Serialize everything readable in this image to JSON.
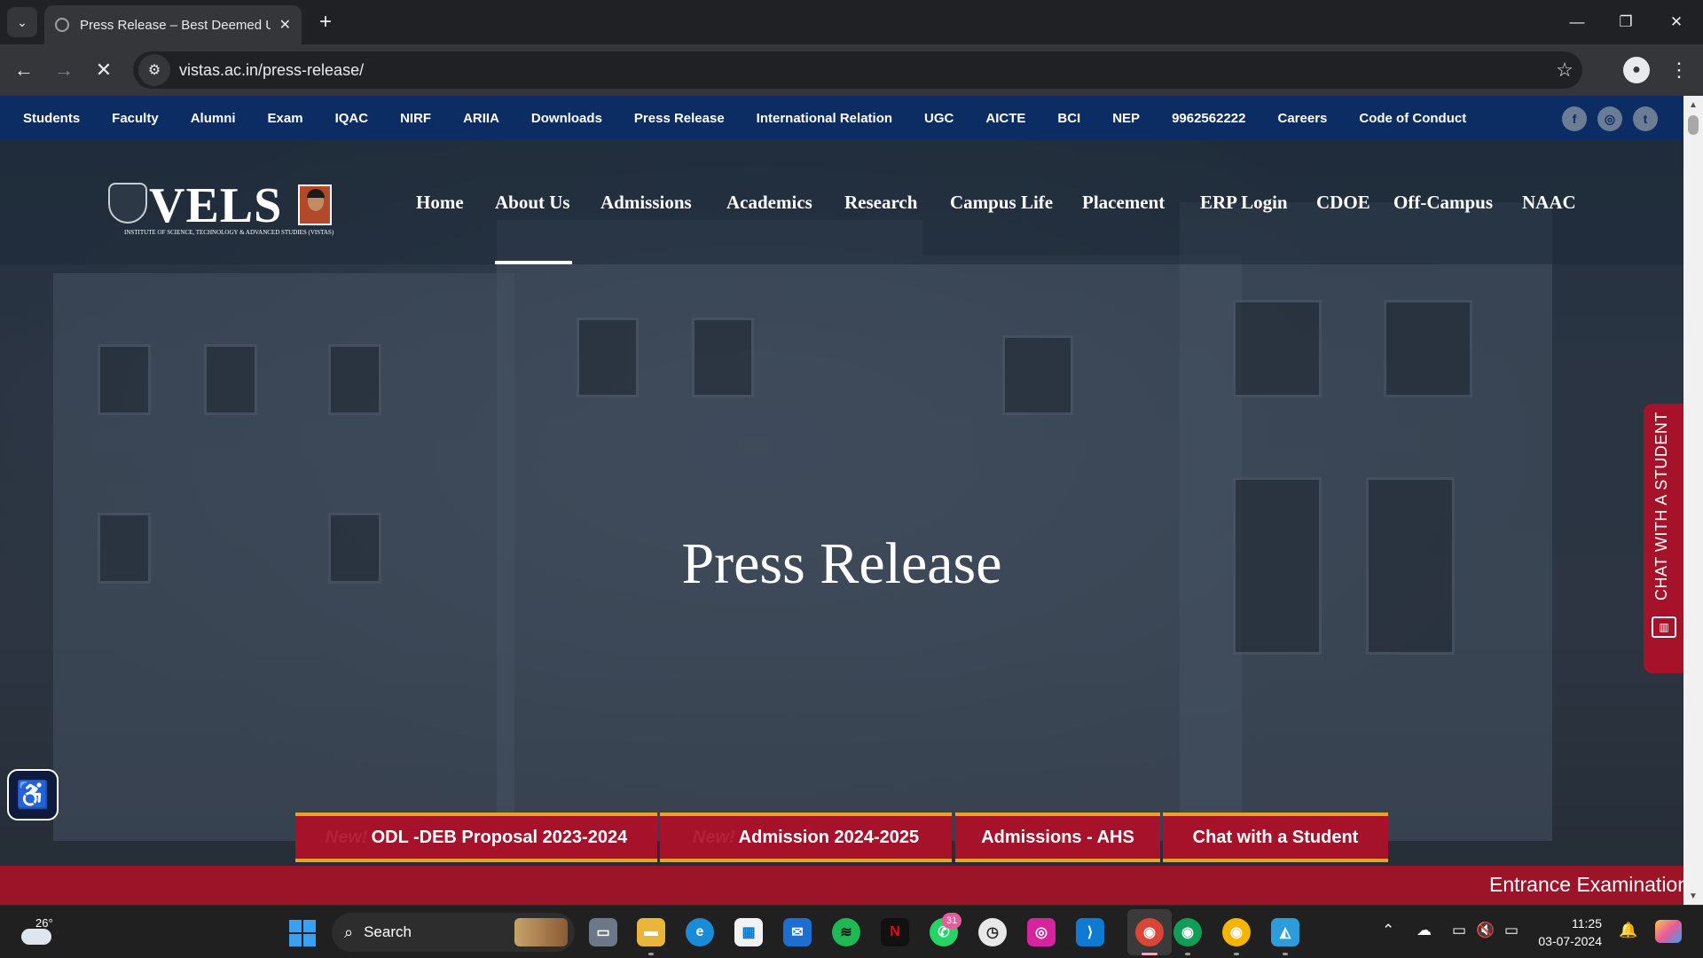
{
  "browser": {
    "tab_title": "Press Release – Best Deemed U",
    "url": "vistas.ac.in/press-release/",
    "icons": {
      "tab_list": "chevron-down-icon",
      "new_tab": "plus-icon",
      "back": "arrow-left-icon",
      "forward": "arrow-right-icon",
      "stop": "close-icon",
      "site_info": "tune-icon",
      "bookmark": "star-icon",
      "profile": "person-icon",
      "menu": "kebab-icon"
    }
  },
  "glyphs": {
    "chevron": "⌄",
    "close": "✕",
    "plus": "+",
    "back": "←",
    "forward": "→",
    "minimize": "—",
    "restore": "❐",
    "site": "⚙",
    "star": "☆",
    "person": "●",
    "kebab": "⋮",
    "scroll_up": "▲",
    "scroll_down": "▼",
    "a11y": "♿",
    "search": "⌕",
    "chevron_up": "⌃",
    "cloud": "☁",
    "monitor": "▭",
    "mute": "🔇",
    "battery": "▭",
    "bell": "🔔"
  },
  "top_bar": {
    "links": [
      "Students",
      "Faculty",
      "Alumni",
      "Exam",
      "IQAC",
      "NIRF",
      "ARIIA",
      "Downloads",
      "Press Release",
      "International Relation",
      "UGC",
      "AICTE",
      "BCI",
      "NEP",
      "9962562222",
      "Careers",
      "Code of Conduct"
    ],
    "social": [
      {
        "icon": "facebook-icon",
        "glyph": "f"
      },
      {
        "icon": "instagram-icon",
        "glyph": "◎"
      },
      {
        "icon": "twitter-icon",
        "glyph": "t"
      }
    ]
  },
  "logo": {
    "word": "VELS",
    "subtitle": "INSTITUTE OF SCIENCE, TECHNOLOGY & ADVANCED STUDIES (VISTAS)"
  },
  "main_nav": {
    "items": [
      "Home",
      "About Us",
      "Admissions",
      "Academics",
      "Research",
      "Campus Life",
      "Placement",
      "ERP Login",
      "CDOE",
      "Off-Campus",
      "NAAC"
    ],
    "active": "About Us"
  },
  "hero": {
    "title": "Press Release"
  },
  "chat_tab": {
    "label": "CHAT WITH A STUDENT"
  },
  "cta_buttons": [
    {
      "new_tag": "New!",
      "label": "ODL -DEB Proposal 2023-2024"
    },
    {
      "new_tag": "New!",
      "label": "Admission 2024-2025"
    },
    {
      "new_tag": "",
      "label": "Admissions - AHS"
    },
    {
      "new_tag": "",
      "label": "Chat with a Student"
    }
  ],
  "ticker": {
    "text": "Entrance Examination"
  },
  "taskbar": {
    "weather_temp": "26°",
    "search_label": "Search",
    "apps": [
      "file-explorer-icon",
      "task-view-icon",
      "edge-icon",
      "store-icon",
      "mail-icon",
      "spotify-icon",
      "netflix-icon",
      "whatsapp-icon",
      "clock-icon",
      "instagram-icon",
      "vscode-icon",
      "chrome-icon",
      "chrome-profile-icon",
      "chrome-profile-2-icon",
      "photos-icon"
    ],
    "whatsapp_badge": "31",
    "time": "11:25",
    "date": "03-07-2024",
    "colors": {
      "start": "#3aa0f2",
      "active_indicator": "#f4a6c4"
    }
  },
  "colors": {
    "top_bar": "#0b2d63",
    "brand_red": "#a5122a",
    "cta_border": "#e7a526"
  }
}
